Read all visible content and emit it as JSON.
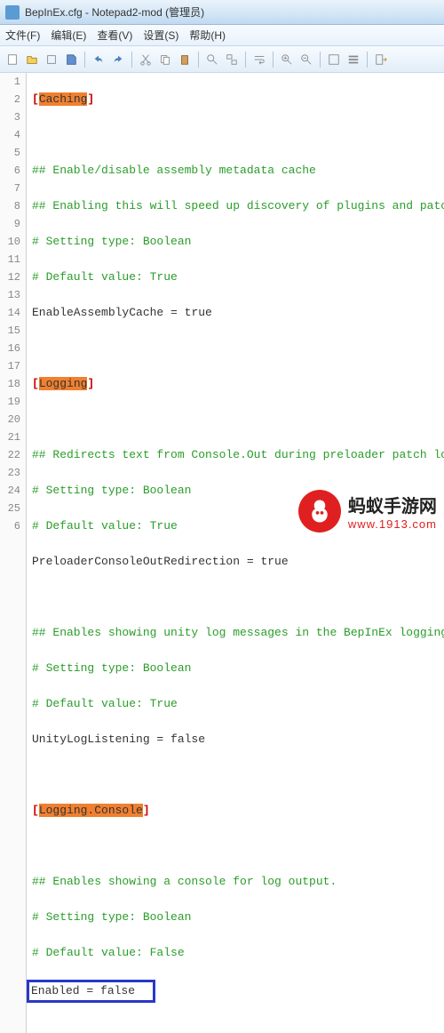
{
  "window": {
    "title": "BepInEx.cfg - Notepad2-mod (管理员)"
  },
  "menu": {
    "file": "文件(F)",
    "edit": "编辑(E)",
    "view": "查看(V)",
    "settings": "设置(S)",
    "help": "帮助(H)"
  },
  "lines": {
    "l1": "1",
    "l2": "2",
    "l3": "3",
    "l4": "4",
    "l5": "5",
    "l6": "6",
    "l7": "7",
    "l8": "8",
    "l9": "9",
    "l10": "10",
    "l11": "11",
    "l12": "12",
    "l13": "13",
    "l14": "14",
    "l15": "15",
    "l16": "16",
    "l17": "17",
    "l18": "18",
    "l19": "19",
    "l20": "20",
    "l21": "21",
    "l22": "22",
    "l23": "23",
    "l24": "24",
    "l25": "25",
    "l26": "6"
  },
  "code": {
    "br_l": "[",
    "br_r": "]",
    "sec1": "Caching",
    "c1": "## Enable/disable assembly metadata cache",
    "c2": "## Enabling this will speed up discovery of plugins and patc",
    "c3": "# Setting type: Boolean",
    "c4": "# Default value: True",
    "k1": "EnableAssemblyCache",
    "eq": " = ",
    "v1": "true",
    "sec2": "Logging",
    "c5": "## Redirects text from Console.Out during preloader patch lo",
    "c6": "# Setting type: Boolean",
    "c7": "# Default value: True",
    "k2": "PreloaderConsoleOutRedirection",
    "v2": "true",
    "c8": "## Enables showing unity log messages in the BepInEx logging",
    "c9": "# Setting type: Boolean",
    "c10": "# Default value: True",
    "k3": "UnityLogListening",
    "v3": "false",
    "sec3": "Logging.Console",
    "c11": "## Enables showing a console for log output.",
    "c12": "# Setting type: Boolean",
    "c13": "# Default value: False",
    "k4": "Enabled",
    "v4": "false"
  },
  "wm": {
    "name": "蚂蚁手游网",
    "url": "www.1913.com"
  }
}
